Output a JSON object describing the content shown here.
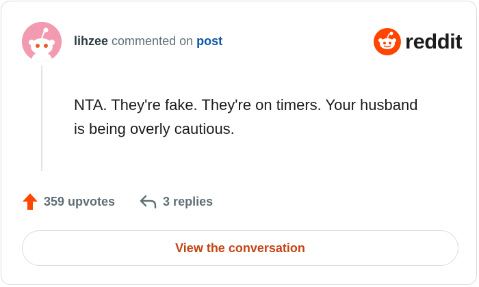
{
  "comment": {
    "username": "lihzee",
    "action_text": "commented on",
    "post_link": "post",
    "body": "NTA. They're fake. They're on timers. Your husband is being overly cautious."
  },
  "brand": {
    "name": "reddit",
    "color": "#ff4500"
  },
  "actions": {
    "upvotes": "359 upvotes",
    "replies": "3 replies"
  },
  "cta": {
    "label": "View the conversation"
  },
  "icons": [
    "avatar-snoo",
    "reddit-logo-icon",
    "upvote-arrow-icon",
    "reply-arrow-icon"
  ],
  "colors": {
    "upvote": "#ff4500",
    "link": "#0a56a8",
    "cta": "#c24514",
    "avatar_bg": "#f29ab0"
  }
}
